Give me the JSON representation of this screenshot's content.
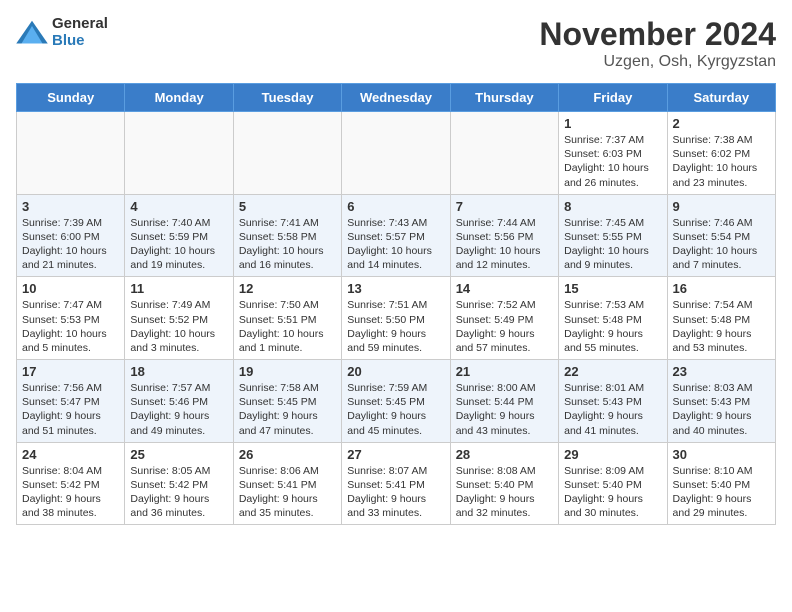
{
  "logo": {
    "general": "General",
    "blue": "Blue"
  },
  "title": "November 2024",
  "location": "Uzgen, Osh, Kyrgyzstan",
  "days_of_week": [
    "Sunday",
    "Monday",
    "Tuesday",
    "Wednesday",
    "Thursday",
    "Friday",
    "Saturday"
  ],
  "weeks": [
    [
      {
        "day": "",
        "info": ""
      },
      {
        "day": "",
        "info": ""
      },
      {
        "day": "",
        "info": ""
      },
      {
        "day": "",
        "info": ""
      },
      {
        "day": "",
        "info": ""
      },
      {
        "day": "1",
        "info": "Sunrise: 7:37 AM\nSunset: 6:03 PM\nDaylight: 10 hours and 26 minutes."
      },
      {
        "day": "2",
        "info": "Sunrise: 7:38 AM\nSunset: 6:02 PM\nDaylight: 10 hours and 23 minutes."
      }
    ],
    [
      {
        "day": "3",
        "info": "Sunrise: 7:39 AM\nSunset: 6:00 PM\nDaylight: 10 hours and 21 minutes."
      },
      {
        "day": "4",
        "info": "Sunrise: 7:40 AM\nSunset: 5:59 PM\nDaylight: 10 hours and 19 minutes."
      },
      {
        "day": "5",
        "info": "Sunrise: 7:41 AM\nSunset: 5:58 PM\nDaylight: 10 hours and 16 minutes."
      },
      {
        "day": "6",
        "info": "Sunrise: 7:43 AM\nSunset: 5:57 PM\nDaylight: 10 hours and 14 minutes."
      },
      {
        "day": "7",
        "info": "Sunrise: 7:44 AM\nSunset: 5:56 PM\nDaylight: 10 hours and 12 minutes."
      },
      {
        "day": "8",
        "info": "Sunrise: 7:45 AM\nSunset: 5:55 PM\nDaylight: 10 hours and 9 minutes."
      },
      {
        "day": "9",
        "info": "Sunrise: 7:46 AM\nSunset: 5:54 PM\nDaylight: 10 hours and 7 minutes."
      }
    ],
    [
      {
        "day": "10",
        "info": "Sunrise: 7:47 AM\nSunset: 5:53 PM\nDaylight: 10 hours and 5 minutes."
      },
      {
        "day": "11",
        "info": "Sunrise: 7:49 AM\nSunset: 5:52 PM\nDaylight: 10 hours and 3 minutes."
      },
      {
        "day": "12",
        "info": "Sunrise: 7:50 AM\nSunset: 5:51 PM\nDaylight: 10 hours and 1 minute."
      },
      {
        "day": "13",
        "info": "Sunrise: 7:51 AM\nSunset: 5:50 PM\nDaylight: 9 hours and 59 minutes."
      },
      {
        "day": "14",
        "info": "Sunrise: 7:52 AM\nSunset: 5:49 PM\nDaylight: 9 hours and 57 minutes."
      },
      {
        "day": "15",
        "info": "Sunrise: 7:53 AM\nSunset: 5:48 PM\nDaylight: 9 hours and 55 minutes."
      },
      {
        "day": "16",
        "info": "Sunrise: 7:54 AM\nSunset: 5:48 PM\nDaylight: 9 hours and 53 minutes."
      }
    ],
    [
      {
        "day": "17",
        "info": "Sunrise: 7:56 AM\nSunset: 5:47 PM\nDaylight: 9 hours and 51 minutes."
      },
      {
        "day": "18",
        "info": "Sunrise: 7:57 AM\nSunset: 5:46 PM\nDaylight: 9 hours and 49 minutes."
      },
      {
        "day": "19",
        "info": "Sunrise: 7:58 AM\nSunset: 5:45 PM\nDaylight: 9 hours and 47 minutes."
      },
      {
        "day": "20",
        "info": "Sunrise: 7:59 AM\nSunset: 5:45 PM\nDaylight: 9 hours and 45 minutes."
      },
      {
        "day": "21",
        "info": "Sunrise: 8:00 AM\nSunset: 5:44 PM\nDaylight: 9 hours and 43 minutes."
      },
      {
        "day": "22",
        "info": "Sunrise: 8:01 AM\nSunset: 5:43 PM\nDaylight: 9 hours and 41 minutes."
      },
      {
        "day": "23",
        "info": "Sunrise: 8:03 AM\nSunset: 5:43 PM\nDaylight: 9 hours and 40 minutes."
      }
    ],
    [
      {
        "day": "24",
        "info": "Sunrise: 8:04 AM\nSunset: 5:42 PM\nDaylight: 9 hours and 38 minutes."
      },
      {
        "day": "25",
        "info": "Sunrise: 8:05 AM\nSunset: 5:42 PM\nDaylight: 9 hours and 36 minutes."
      },
      {
        "day": "26",
        "info": "Sunrise: 8:06 AM\nSunset: 5:41 PM\nDaylight: 9 hours and 35 minutes."
      },
      {
        "day": "27",
        "info": "Sunrise: 8:07 AM\nSunset: 5:41 PM\nDaylight: 9 hours and 33 minutes."
      },
      {
        "day": "28",
        "info": "Sunrise: 8:08 AM\nSunset: 5:40 PM\nDaylight: 9 hours and 32 minutes."
      },
      {
        "day": "29",
        "info": "Sunrise: 8:09 AM\nSunset: 5:40 PM\nDaylight: 9 hours and 30 minutes."
      },
      {
        "day": "30",
        "info": "Sunrise: 8:10 AM\nSunset: 5:40 PM\nDaylight: 9 hours and 29 minutes."
      }
    ]
  ]
}
